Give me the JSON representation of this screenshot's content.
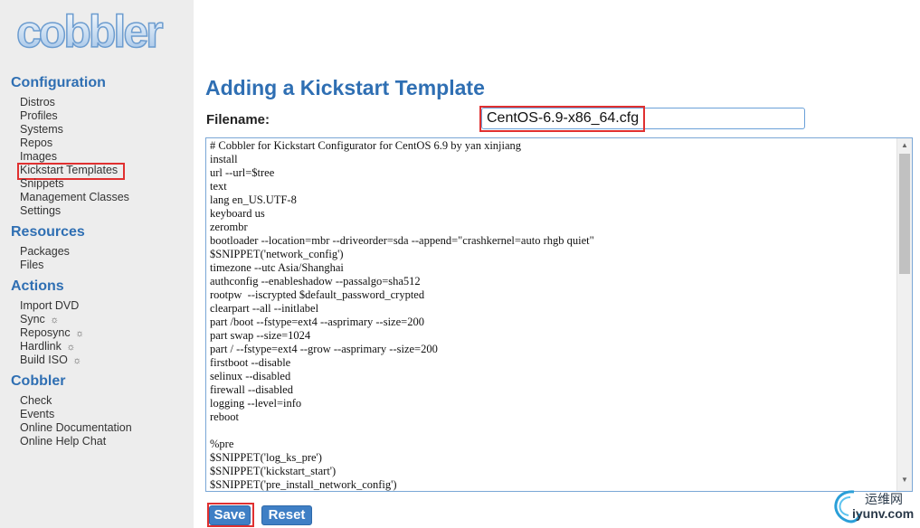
{
  "logo": {
    "text": "cobbler"
  },
  "sidebar": {
    "sections": [
      {
        "title": "Configuration",
        "items": [
          "Distros",
          "Profiles",
          "Systems",
          "Repos",
          "Images",
          "Kickstart Templates",
          "Snippets",
          "Management Classes",
          "Settings"
        ]
      },
      {
        "title": "Resources",
        "items": [
          "Packages",
          "Files"
        ]
      },
      {
        "title": "Actions",
        "items": [
          "Import DVD",
          "Sync",
          "Reposync",
          "Hardlink",
          "Build ISO"
        ]
      },
      {
        "title": "Cobbler",
        "items": [
          "Check",
          "Events",
          "Online Documentation",
          "Online Help Chat"
        ]
      }
    ],
    "gear_icon": "☼",
    "highlighted_item": "Kickstart Templates"
  },
  "main": {
    "title": "Adding a Kickstart Template",
    "filename_label": "Filename:",
    "filename_value": "CentOS-6.9-x86_64.cfg",
    "editor_lines": [
      "# Cobbler for Kickstart Configurator for CentOS 6.9 by yan xinjiang",
      "install",
      "url --url=$tree",
      "text",
      "lang en_US.UTF-8",
      "keyboard us",
      "zerombr",
      "bootloader --location=mbr --driveorder=sda --append=\"crashkernel=auto rhgb quiet\"",
      "$SNIPPET('network_config')",
      "timezone --utc Asia/Shanghai",
      "authconfig --enableshadow --passalgo=sha512",
      "rootpw  --iscrypted $default_password_crypted",
      "clearpart --all --initlabel",
      "part /boot --fstype=ext4 --asprimary --size=200",
      "part swap --size=1024",
      "part / --fstype=ext4 --grow --asprimary --size=200",
      "firstboot --disable",
      "selinux --disabled",
      "firewall --disabled",
      "logging --level=info",
      "reboot",
      "",
      "%pre",
      "$SNIPPET('log_ks_pre')",
      "$SNIPPET('kickstart_start')",
      "$SNIPPET('pre_install_network_config')"
    ],
    "save_label": "Save",
    "reset_label": "Reset"
  },
  "watermark": {
    "cn": "运维网",
    "url": "iyunv.com"
  },
  "colors": {
    "accent": "#2f6fb3",
    "button": "#3f7fc5",
    "highlight": "#e03030",
    "sidebar_bg": "#ededed"
  }
}
